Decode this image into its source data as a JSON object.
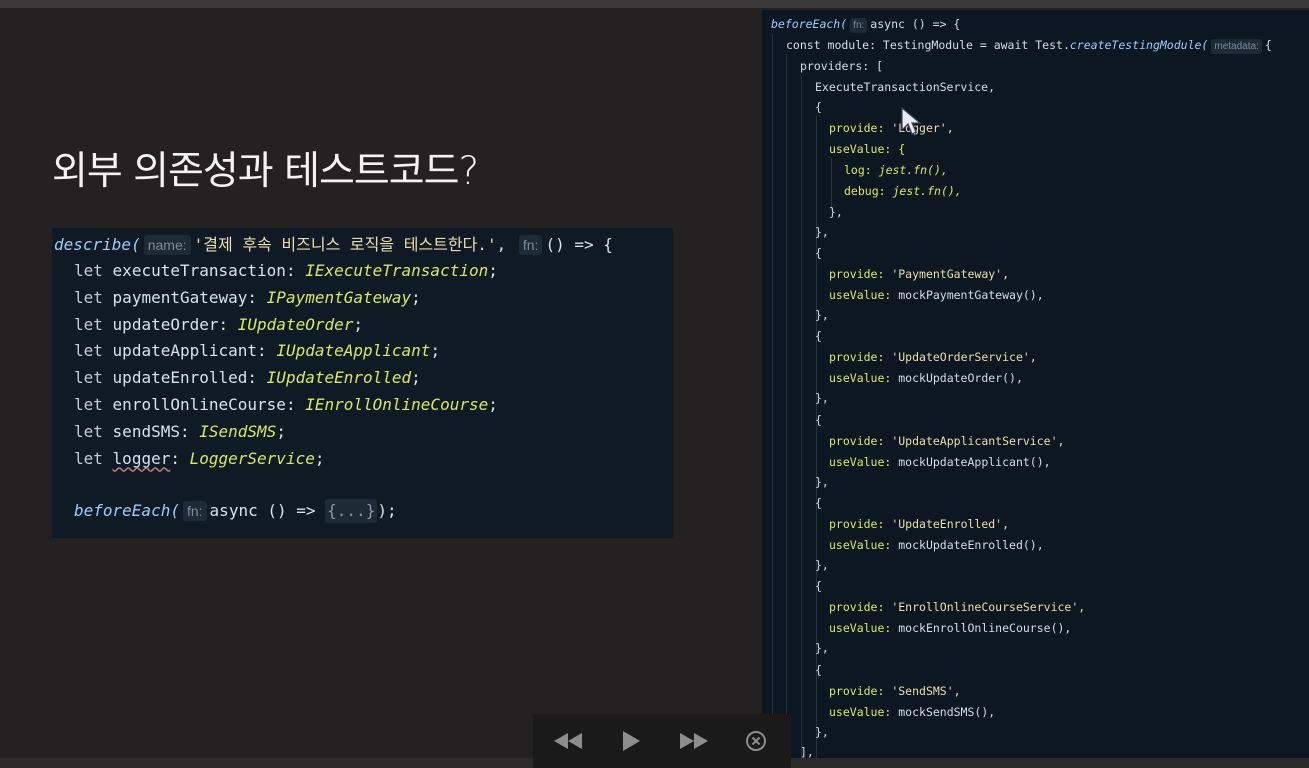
{
  "slide": {
    "title": "외부 의존성과 테스트코드?"
  },
  "left_code": {
    "describe_fn": "describe(",
    "name_hint": "name:",
    "describe_label": "'결제 후속 비즈니스 로직을 테스트한다.'",
    "comma": ",",
    "fn_hint": "fn:",
    "arrow_open": "() => {",
    "declarations": [
      {
        "kw": "let",
        "name": "executeTransaction",
        "type": "IExecuteTransaction"
      },
      {
        "kw": "let",
        "name": "paymentGateway",
        "type": "IPaymentGateway"
      },
      {
        "kw": "let",
        "name": "updateOrder",
        "type": "IUpdateOrder"
      },
      {
        "kw": "let",
        "name": "updateApplicant",
        "type": "IUpdateApplicant"
      },
      {
        "kw": "let",
        "name": "updateEnrolled",
        "type": "IUpdateEnrolled"
      },
      {
        "kw": "let",
        "name": "enrollOnlineCourse",
        "type": "IEnrollOnlineCourse"
      },
      {
        "kw": "let",
        "name": "sendSMS",
        "type": "ISendSMS"
      },
      {
        "kw": "let",
        "name": "logger",
        "type": "LoggerService"
      }
    ],
    "before_each": "beforeEach(",
    "before_fn_hint": "fn:",
    "before_async": "async () =>",
    "folded": "{...}",
    "before_close": ");"
  },
  "right_code": {
    "line1": {
      "fn": "beforeEach(",
      "hint": "fn:",
      "rest": "async () => {"
    },
    "line2": {
      "pre": "const module: TestingModule = await Test.",
      "fn": "createTestingModule(",
      "hint": "metadata:",
      "post": "{"
    },
    "line3": "providers: [",
    "line4": "ExecuteTransactionService,",
    "open_brace": "{",
    "logger_provide_key": "provide:",
    "logger_provide_val": "'Logger',",
    "usevalue_open": "useValue: {",
    "log_key": "log:",
    "log_val": "jest.fn(),",
    "debug_key": "debug:",
    "debug_val": "jest.fn(),",
    "inner_close": "},",
    "outer_close": "},",
    "providers": [
      {
        "provide": "'PaymentGateway',",
        "use_value": "mockPaymentGateway(),"
      },
      {
        "provide": "'UpdateOrderService',",
        "use_value": "mockUpdateOrder(),"
      },
      {
        "provide": "'UpdateApplicantService',",
        "use_value": "mockUpdateApplicant(),"
      },
      {
        "provide": "'UpdateEnrolled',",
        "use_value": "mockUpdateEnrolled(),"
      },
      {
        "provide": "'EnrollOnlineCourseService',",
        "use_value": "mockEnrollOnlineCourse(),"
      },
      {
        "provide": "'SendSMS',",
        "use_value": "mockSendSMS(),"
      }
    ],
    "provide_key": "provide:",
    "usevalue_key": "useValue:",
    "array_close": "],"
  },
  "media_controls": {
    "rewind_icon": "rewind-icon",
    "play_icon": "play-icon",
    "forward_icon": "fast-forward-icon",
    "close_icon": "close-circle-icon"
  },
  "colors": {
    "background": "#232122",
    "code_bg": "#0d1722",
    "type_color": "#d7e86b",
    "string_color": "#eadfb0",
    "function_color": "#a5c8ff"
  }
}
